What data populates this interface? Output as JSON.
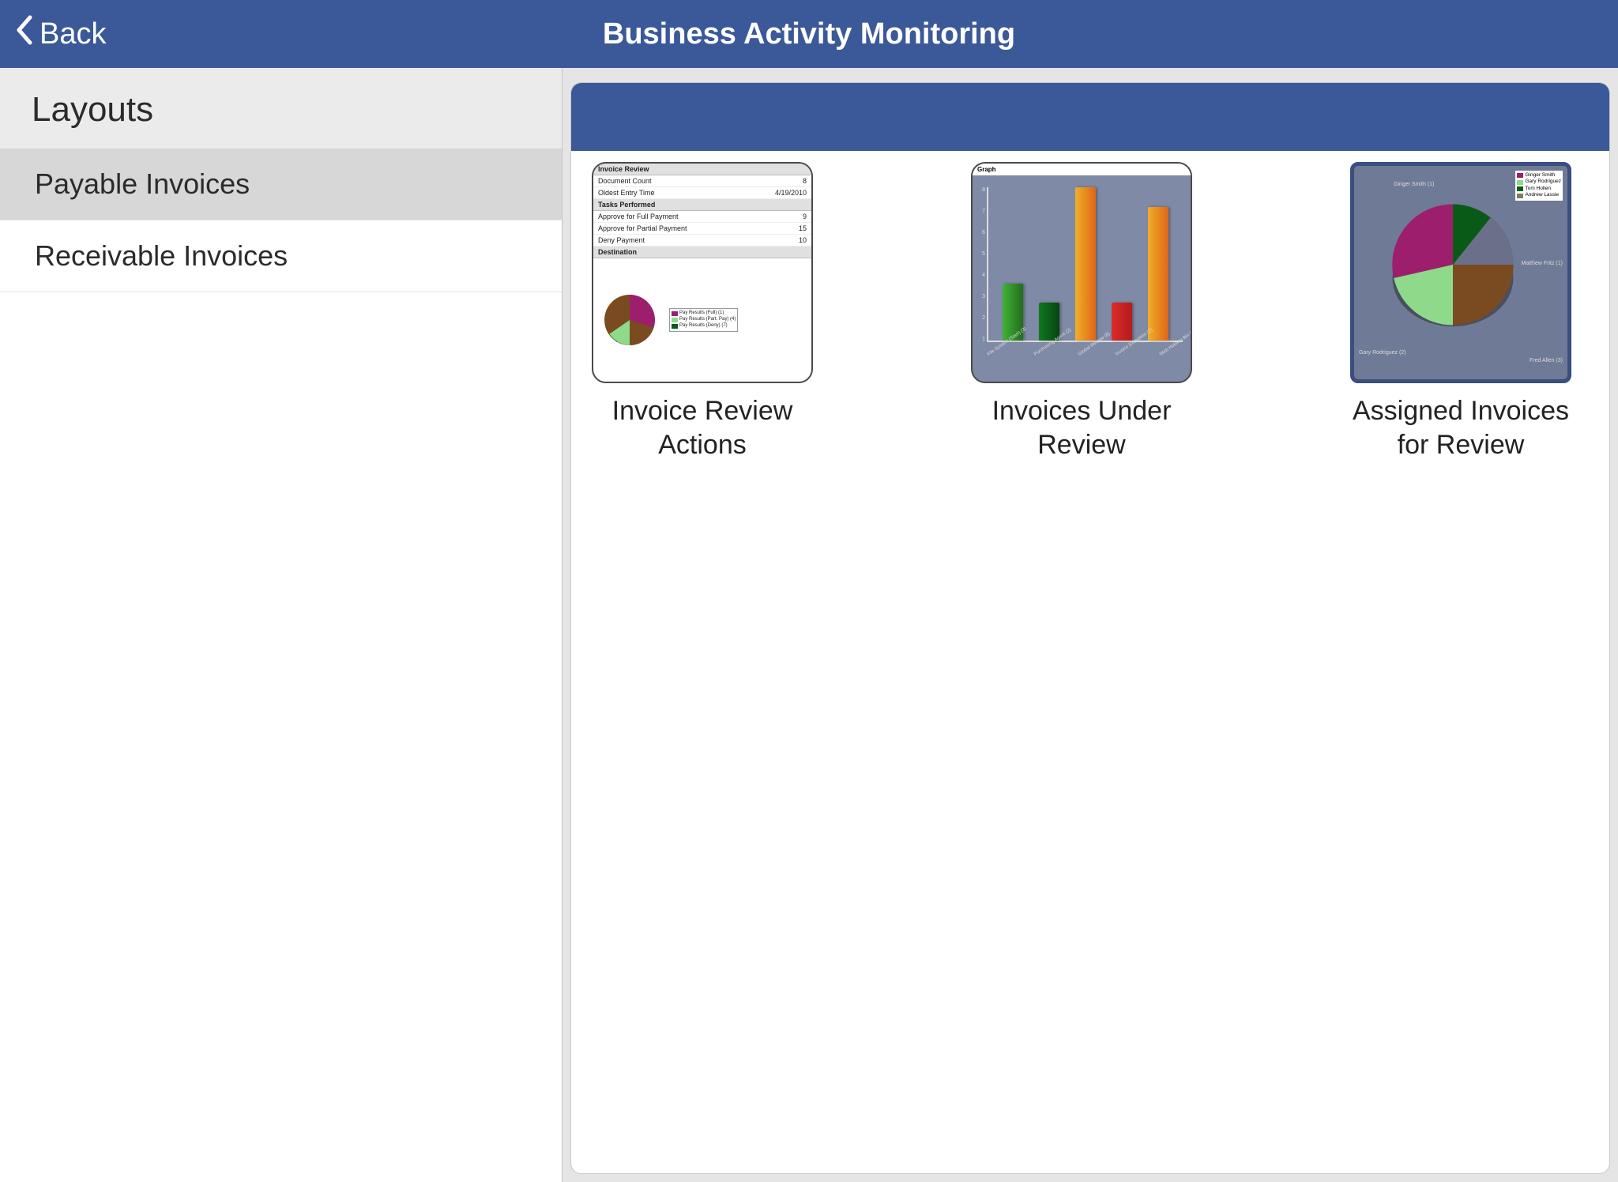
{
  "header": {
    "back_label": "Back",
    "title": "Business Activity Monitoring"
  },
  "sidebar": {
    "section_label": "Layouts",
    "items": [
      {
        "label": "Payable Invoices",
        "selected": true
      },
      {
        "label": "Receivable Invoices",
        "selected": false
      }
    ]
  },
  "layouts": [
    {
      "label": "Invoice Review Actions"
    },
    {
      "label": "Invoices Under Review"
    },
    {
      "label": "Assigned Invoices for Review"
    }
  ],
  "thumb_report": {
    "section1": "Invoice Review",
    "rows1": [
      {
        "k": "Document Count",
        "v": "8"
      },
      {
        "k": "Oldest Entry Time",
        "v": "4/19/2010"
      }
    ],
    "section2": "Tasks Performed",
    "rows2": [
      {
        "k": "Approve for Full Payment",
        "v": "9"
      },
      {
        "k": "Approve for Partial Payment",
        "v": "15"
      },
      {
        "k": "Deny Payment",
        "v": "10"
      }
    ],
    "section3": "Destination",
    "legend": [
      {
        "label": "Pay Results (Full) (1)",
        "color": "#9d1e6c"
      },
      {
        "label": "Pay Results (Part. Pay) (4)",
        "color": "#8fd98a"
      },
      {
        "label": "Pay Results (Deny) (7)",
        "color": "#0a5a17"
      }
    ]
  },
  "chart_data": [
    {
      "id": "thumb1_pie",
      "type": "pie",
      "title": "Destination",
      "series": [
        {
          "name": "Pay Results (Full)",
          "value": 1,
          "color": "#9d1e6c"
        },
        {
          "name": "Pay Results (Part. Pay)",
          "value": 4,
          "color": "#8fd98a"
        },
        {
          "name": "Pay Results (Deny)",
          "value": 7,
          "color": "#7a4a20"
        }
      ]
    },
    {
      "id": "thumb2_bar",
      "type": "bar",
      "title": "Graph",
      "ylabel": "",
      "ylim": [
        0,
        8
      ],
      "yticks": [
        1,
        2,
        3,
        4,
        5,
        6,
        7,
        8
      ],
      "categories": [
        "File System (Start) (3)",
        "Purchasing Agent (2)",
        "Global Review (8)",
        "Invoice Exception (2)",
        "Web Holding Bin (7)"
      ],
      "values": [
        3,
        2,
        8,
        2,
        7
      ],
      "colors": [
        "#2f8a28",
        "#0a5a17",
        "#e6841e",
        "#c62121",
        "#e6841e"
      ]
    },
    {
      "id": "thumb3_pie",
      "type": "pie",
      "title": "",
      "series": [
        {
          "name": "Ginger Smith",
          "value": 1,
          "color": "#9d1e6c"
        },
        {
          "name": "Gary Rodriguez",
          "value": 2,
          "color": "#8fd98a"
        },
        {
          "name": "Tom Hollen",
          "value": 1,
          "color": "#0a5a17"
        },
        {
          "name": "Andrew Lassie",
          "value": 0,
          "color": "#7f7f58"
        },
        {
          "name": "Matthew Fritz",
          "value": 1,
          "color": "#6a6f8a"
        },
        {
          "name": "Fred Allen",
          "value": 3,
          "color": "#7a4a20"
        }
      ],
      "labels_around": [
        "Ginger Smith (1)",
        "Matthew Fritz (1)",
        "Fred Allen (3)",
        "Gary Rodriguez (2)"
      ]
    }
  ]
}
